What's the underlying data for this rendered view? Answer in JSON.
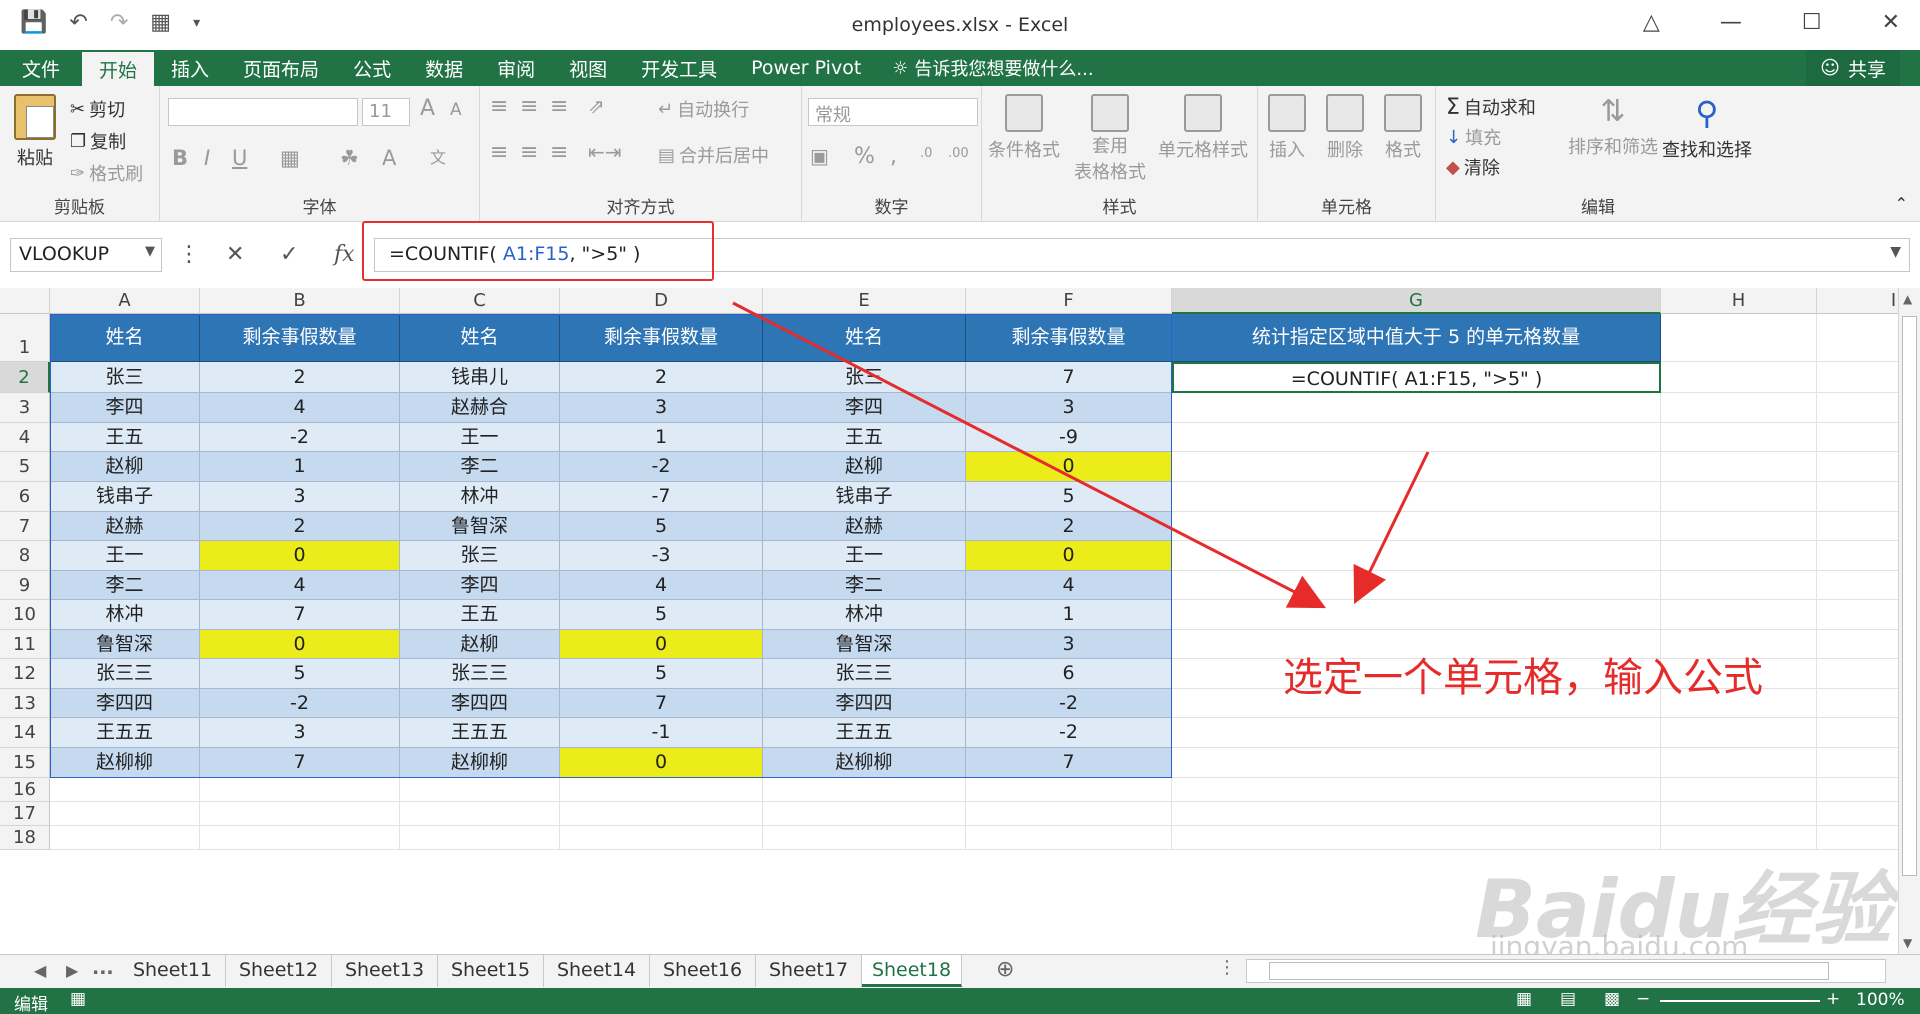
{
  "window": {
    "title": "employees.xlsx - Excel",
    "controls": [
      "restore-ribbon",
      "minimize",
      "maximize",
      "close"
    ]
  },
  "tabs": {
    "file": "文件",
    "items": [
      "开始",
      "插入",
      "页面布局",
      "公式",
      "数据",
      "审阅",
      "视图",
      "开发工具",
      "Power Pivot"
    ],
    "active": "开始",
    "tell_me": "告诉我您想要做什么...",
    "share": "共享"
  },
  "ribbon": {
    "clipboard": {
      "label": "剪贴板",
      "paste": "粘贴",
      "cut": "剪切",
      "copy": "复制",
      "painter": "格式刷"
    },
    "font": {
      "label": "字体",
      "size": "11",
      "bold": "B",
      "italic": "I",
      "underline": "U",
      "grow": "A",
      "shrink": "A"
    },
    "align": {
      "label": "对齐方式",
      "wrap": "自动换行",
      "merge": "合并后居中"
    },
    "number": {
      "label": "数字",
      "format": "常规",
      "percent": "%"
    },
    "styles": {
      "label": "样式",
      "conditional": "条件格式",
      "table_line1": "套用",
      "table_line2": "表格格式",
      "cell_styles": "单元格样式"
    },
    "cells": {
      "label": "单元格",
      "insert": "插入",
      "delete": "删除",
      "format": "格式"
    },
    "editing": {
      "label": "编辑",
      "autosum": "自动求和",
      "fill": "填充",
      "clear": "清除",
      "sort": "排序和筛选",
      "find": "查找和选择"
    }
  },
  "formula_bar": {
    "name_box": "VLOOKUP",
    "fx": "fx",
    "formula_prefix": "=COUNTIF( ",
    "formula_range": "A1:F15",
    "formula_suffix": ", \">5\" )"
  },
  "columns": [
    "A",
    "B",
    "C",
    "D",
    "E",
    "F",
    "G",
    "H",
    "I"
  ],
  "selected_column": "G",
  "rows": [
    "1",
    "2",
    "3",
    "4",
    "5",
    "6",
    "7",
    "8",
    "9",
    "10",
    "11",
    "12",
    "13",
    "14",
    "15",
    "16",
    "17",
    "18"
  ],
  "selected_row": "2",
  "table": {
    "headers": [
      "姓名",
      "剩余事假数量",
      "姓名",
      "剩余事假数量",
      "姓名",
      "剩余事假数量"
    ],
    "data": [
      [
        "张三",
        "2",
        "钱串儿",
        "2",
        "张三",
        "7"
      ],
      [
        "李四",
        "4",
        "赵赫合",
        "3",
        "李四",
        "3"
      ],
      [
        "王五",
        "-2",
        "王一",
        "1",
        "王五",
        "-9"
      ],
      [
        "赵柳",
        "1",
        "李二",
        "-2",
        "赵柳",
        "0"
      ],
      [
        "钱串子",
        "3",
        "林冲",
        "-7",
        "钱串子",
        "5"
      ],
      [
        "赵赫",
        "2",
        "鲁智深",
        "5",
        "赵赫",
        "2"
      ],
      [
        "王一",
        "0",
        "张三",
        "-3",
        "王一",
        "0"
      ],
      [
        "李二",
        "4",
        "李四",
        "4",
        "李二",
        "4"
      ],
      [
        "林冲",
        "7",
        "王五",
        "5",
        "林冲",
        "1"
      ],
      [
        "鲁智深",
        "0",
        "赵柳",
        "0",
        "鲁智深",
        "3"
      ],
      [
        "张三三",
        "5",
        "张三三",
        "5",
        "张三三",
        "6"
      ],
      [
        "李四四",
        "-2",
        "李四四",
        "7",
        "李四四",
        "-2"
      ],
      [
        "王五五",
        "3",
        "王五五",
        "-1",
        "王五五",
        "-2"
      ],
      [
        "赵柳柳",
        "7",
        "赵柳柳",
        "0",
        "赵柳柳",
        "7"
      ]
    ],
    "g_header": "统计指定区域中值大于 5 的单元格数量",
    "g_formula": "=COUNTIF( A1:F15, \">5\" )"
  },
  "annotation": "选定一个单元格，输入公式",
  "sheets": {
    "ellipsis": "...",
    "items": [
      "Sheet11",
      "Sheet12",
      "Sheet13",
      "Sheet15",
      "Sheet14",
      "Sheet16",
      "Sheet17",
      "Sheet18"
    ],
    "active": "Sheet18"
  },
  "status": {
    "mode": "编辑",
    "zoom": "100%"
  },
  "watermark": {
    "brand": "Baidu经验",
    "url": "jingyan.baidu.com"
  },
  "colors": {
    "excel_green": "#217346",
    "header_blue": "#2e75b6",
    "annotation_red": "#e62b2b",
    "highlight_yellow": "#ecec1a"
  }
}
